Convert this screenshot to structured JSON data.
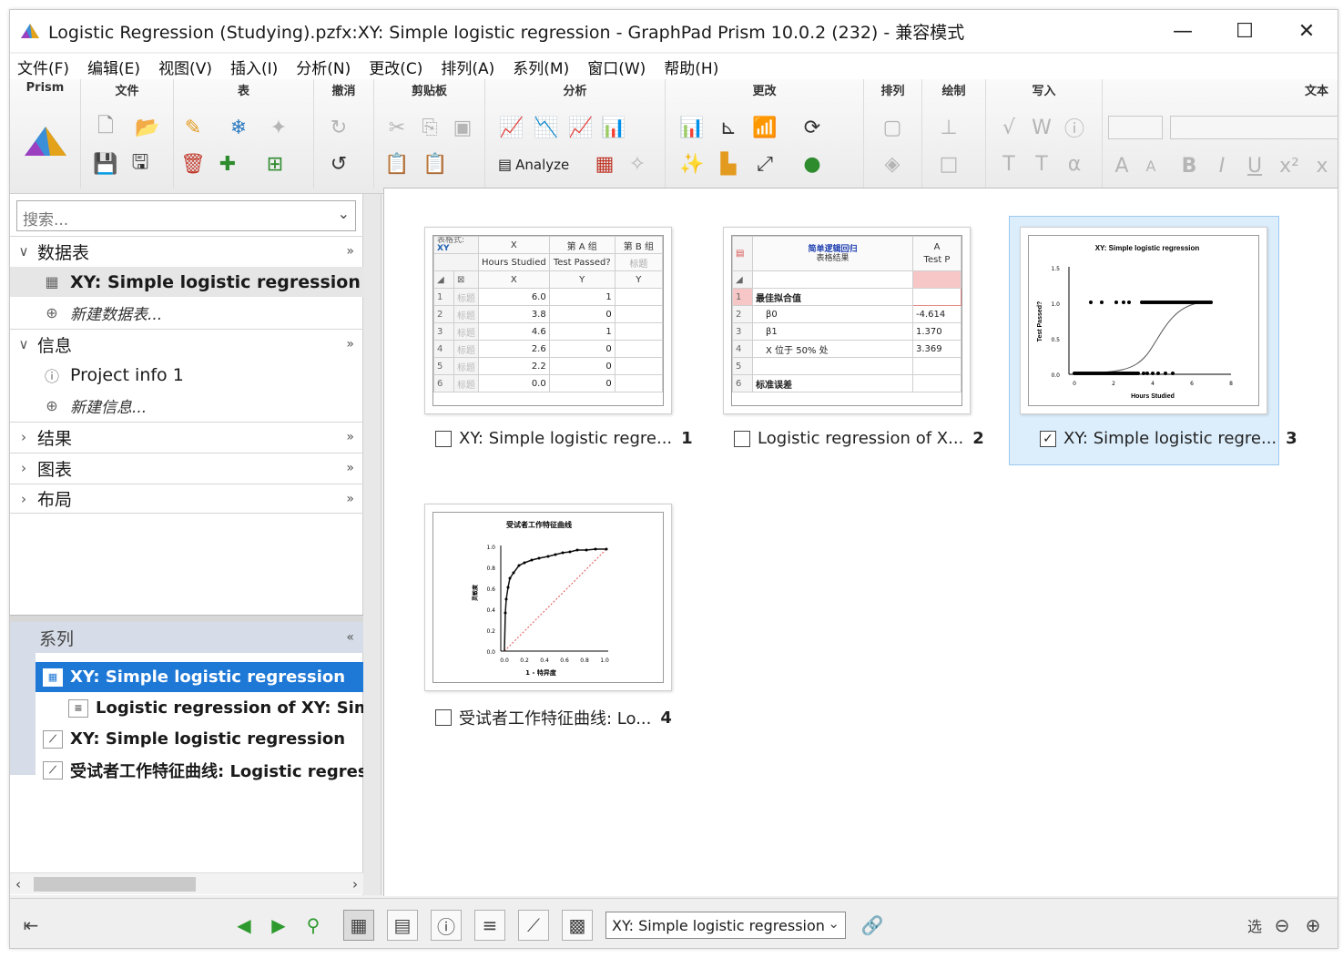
{
  "window": {
    "title": "Logistic Regression (Studying).pzfx:XY: Simple logistic regression - GraphPad Prism 10.0.2 (232) - 兼容模式",
    "controls": {
      "minimize": "—",
      "maximize": "☐",
      "close": "✕"
    }
  },
  "menu": [
    "文件(F)",
    "编辑(E)",
    "视图(V)",
    "插入(I)",
    "分析(N)",
    "更改(C)",
    "排列(A)",
    "系列(M)",
    "窗口(W)",
    "帮助(H)"
  ],
  "ribbon": {
    "groups": [
      "Prism",
      "文件",
      "表",
      "撤消",
      "剪贴板",
      "分析",
      "更改",
      "排列",
      "绘制",
      "写入",
      "文本"
    ],
    "analyze_label": "Analyze"
  },
  "navigator": {
    "search_placeholder": "搜索...",
    "sections": [
      {
        "label": "数据表",
        "expanded": true,
        "items": [
          {
            "label": "XY: Simple logistic regression",
            "selected": true
          },
          {
            "label": "新建数据表...",
            "new": true
          }
        ]
      },
      {
        "label": "信息",
        "expanded": true,
        "items": [
          {
            "label": "Project info 1"
          },
          {
            "label": "新建信息...",
            "new": true
          }
        ]
      },
      {
        "label": "结果",
        "expanded": false,
        "items": []
      },
      {
        "label": "图表",
        "expanded": false,
        "items": []
      },
      {
        "label": "布局",
        "expanded": false,
        "items": []
      }
    ],
    "expand_glyph": "»"
  },
  "family": {
    "title": "系列",
    "collapse_glyph": "«",
    "items": [
      {
        "label": "XY: Simple logistic regression",
        "type": "table",
        "active": true
      },
      {
        "label": "Logistic regression of XY: Simpl",
        "type": "results"
      },
      {
        "label": "XY: Simple logistic regression",
        "type": "graph"
      },
      {
        "label": "受试者工作特征曲线: Logistic regress",
        "type": "graph"
      }
    ]
  },
  "gallery": {
    "cards": [
      {
        "label": "XY: Simple logistic regre...",
        "number": "1",
        "checked": false
      },
      {
        "label": "Logistic regression of X...",
        "number": "2",
        "checked": false
      },
      {
        "label": "XY: Simple logistic regre...",
        "number": "3",
        "checked": true
      },
      {
        "label": "受试者工作特征曲线: Lo...",
        "number": "4",
        "checked": false
      }
    ],
    "table_thumb": {
      "corner_top": "表格式:",
      "corner_bottom": "XY",
      "col_x": "X",
      "col_a": "第 A 组",
      "col_b": "第 B 组",
      "sub_x": "Hours Studied",
      "sub_a": "Test Passed?",
      "sub_b": "标题",
      "x_head": "X",
      "y_head": "Y",
      "row_title": "标题",
      "rows": [
        {
          "n": "1",
          "x": "6.0",
          "y": "1"
        },
        {
          "n": "2",
          "x": "3.8",
          "y": "0"
        },
        {
          "n": "3",
          "x": "4.6",
          "y": "1"
        },
        {
          "n": "4",
          "x": "2.6",
          "y": "0"
        },
        {
          "n": "5",
          "x": "2.2",
          "y": "0"
        },
        {
          "n": "6",
          "x": "0.0",
          "y": "0"
        }
      ]
    },
    "results_thumb": {
      "title1": "简单逻辑回归",
      "title2": "表格结果",
      "col": "Test P",
      "col_letter": "A",
      "rows": [
        {
          "n": "1",
          "label": "最佳拟合值",
          "value": ""
        },
        {
          "n": "2",
          "label": "β0",
          "value": "-4.614"
        },
        {
          "n": "3",
          "label": "β1",
          "value": "1.370"
        },
        {
          "n": "4",
          "label": "X 位于 50% 处",
          "value": "3.369"
        },
        {
          "n": "5",
          "label": "",
          "value": ""
        },
        {
          "n": "6",
          "label": "标准误差",
          "value": ""
        }
      ]
    },
    "logistic_graph": {
      "title": "XY: Simple logistic regression",
      "xlabel": "Hours Studied",
      "ylabel": "Test Passed?",
      "yticks": [
        "1.5",
        "1.0",
        "0.5",
        "0.0"
      ],
      "xticks": [
        "0",
        "2",
        "4",
        "6",
        "8"
      ]
    },
    "roc_graph": {
      "title": "受试者工作特征曲线",
      "xlabel": "1 - 特异度",
      "ylabel": "灵敏度",
      "yticks": [
        "1.0",
        "0.8",
        "0.6",
        "0.4",
        "0.2",
        "0.0"
      ],
      "xticks": [
        "0.0",
        "0.2",
        "0.4",
        "0.6",
        "0.8",
        "1.0"
      ]
    }
  },
  "statusbar": {
    "sheet_select": "XY: Simple logistic regression",
    "zoom_label": "选"
  }
}
